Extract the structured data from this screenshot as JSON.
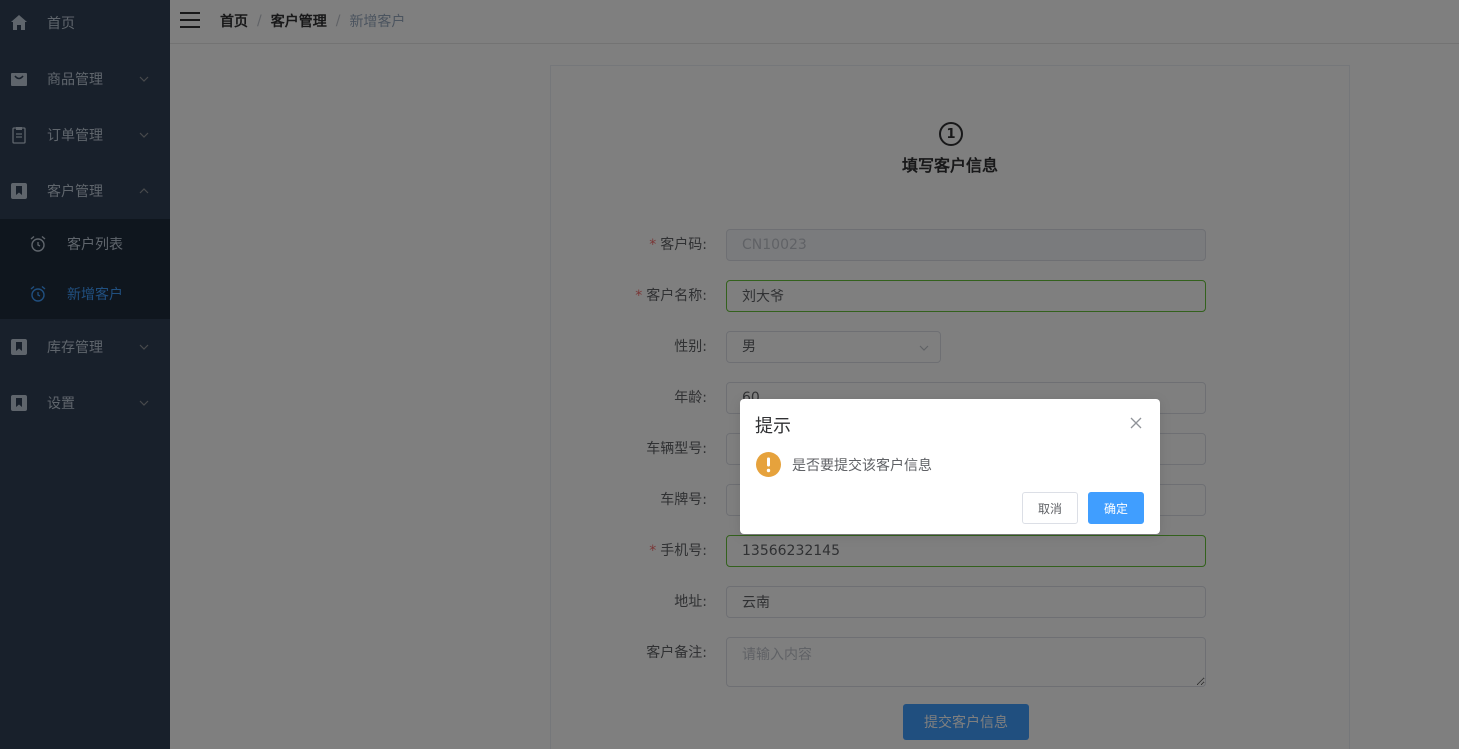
{
  "sidebar": {
    "home": "首页",
    "products": "商品管理",
    "orders": "订单管理",
    "customers": "客户管理",
    "customer_list": "客户列表",
    "add_customer": "新增客户",
    "inventory": "库存管理",
    "settings": "设置"
  },
  "breadcrumb": {
    "home": "首页",
    "customers": "客户管理",
    "current": "新增客户",
    "separator": "/"
  },
  "step": {
    "number": "1",
    "title": "填写客户信息"
  },
  "form": {
    "code_label": "客户码:",
    "code_value": "CN10023",
    "name_label": "客户名称:",
    "name_value": "刘大爷",
    "gender_label": "性别:",
    "gender_value": "男",
    "age_label": "年龄:",
    "age_value": "60",
    "model_label": "车辆型号:",
    "model_value": "",
    "plate_label": "车牌号:",
    "plate_value": "",
    "phone_label": "手机号:",
    "phone_value": "13566232145",
    "address_label": "地址:",
    "address_value": "云南",
    "notes_label": "客户备注:",
    "notes_placeholder": "请输入内容",
    "required_mark": "*",
    "submit_label": "提交客户信息"
  },
  "dialog": {
    "title": "提示",
    "message": "是否要提交该客户信息",
    "cancel": "取消",
    "confirm": "确定"
  },
  "colors": {
    "sidebar_bg": "#304156",
    "submenu_bg": "#1f2d3d",
    "accent": "#409eff",
    "valid_border": "#67c23a",
    "warning": "#e6a23c",
    "required": "#f56c6c"
  }
}
